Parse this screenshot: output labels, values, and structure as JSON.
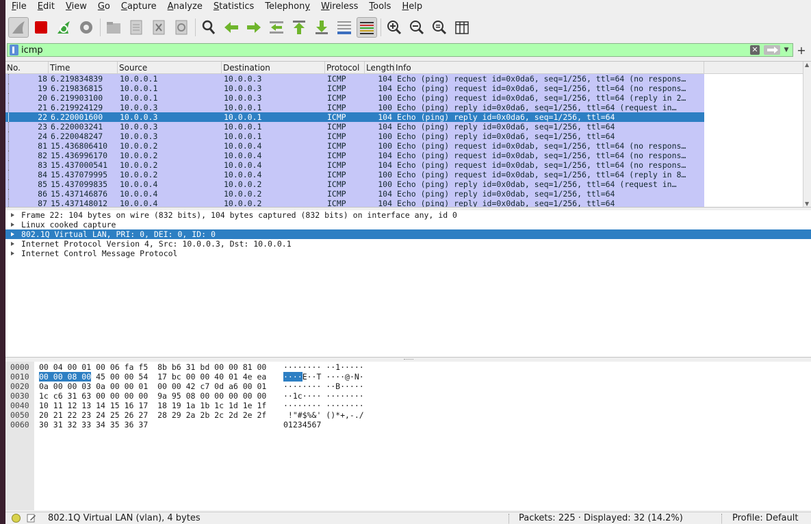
{
  "menu": [
    "File",
    "Edit",
    "View",
    "Go",
    "Capture",
    "Analyze",
    "Statistics",
    "Telephony",
    "Wireless",
    "Tools",
    "Help"
  ],
  "menu_underline": [
    "F",
    "E",
    "V",
    "G",
    "C",
    "A",
    "S",
    "y",
    "W",
    "T",
    "H"
  ],
  "filter": {
    "value": "icmp"
  },
  "columns": [
    "No.",
    "Time",
    "Source",
    "Destination",
    "Protocol",
    "Length",
    "Info"
  ],
  "packets": [
    {
      "no": "18",
      "time": "6.219834839",
      "src": "10.0.0.1",
      "dst": "10.0.0.3",
      "proto": "ICMP",
      "len": "104",
      "info": "Echo (ping) request  id=0x0da6, seq=1/256, ttl=64 (no respons…",
      "selected": false
    },
    {
      "no": "19",
      "time": "6.219836815",
      "src": "10.0.0.1",
      "dst": "10.0.0.3",
      "proto": "ICMP",
      "len": "104",
      "info": "Echo (ping) request  id=0x0da6, seq=1/256, ttl=64 (no respons…",
      "selected": false
    },
    {
      "no": "20",
      "time": "6.219903100",
      "src": "10.0.0.1",
      "dst": "10.0.0.3",
      "proto": "ICMP",
      "len": "100",
      "info": "Echo (ping) request  id=0x0da6, seq=1/256, ttl=64 (reply in 2…",
      "selected": false
    },
    {
      "no": "21",
      "time": "6.219924129",
      "src": "10.0.0.3",
      "dst": "10.0.0.1",
      "proto": "ICMP",
      "len": "100",
      "info": "Echo (ping) reply    id=0x0da6, seq=1/256, ttl=64 (request in…",
      "selected": false
    },
    {
      "no": "22",
      "time": "6.220001600",
      "src": "10.0.0.3",
      "dst": "10.0.0.1",
      "proto": "ICMP",
      "len": "104",
      "info": "Echo (ping) reply    id=0x0da6, seq=1/256, ttl=64",
      "selected": true
    },
    {
      "no": "23",
      "time": "6.220003241",
      "src": "10.0.0.3",
      "dst": "10.0.0.1",
      "proto": "ICMP",
      "len": "104",
      "info": "Echo (ping) reply    id=0x0da6, seq=1/256, ttl=64",
      "selected": false
    },
    {
      "no": "24",
      "time": "6.220048247",
      "src": "10.0.0.3",
      "dst": "10.0.0.1",
      "proto": "ICMP",
      "len": "100",
      "info": "Echo (ping) reply    id=0x0da6, seq=1/256, ttl=64",
      "selected": false
    },
    {
      "no": "81",
      "time": "15.436806410",
      "src": "10.0.0.2",
      "dst": "10.0.0.4",
      "proto": "ICMP",
      "len": "100",
      "info": "Echo (ping) request  id=0x0dab, seq=1/256, ttl=64 (no respons…",
      "selected": false
    },
    {
      "no": "82",
      "time": "15.436996170",
      "src": "10.0.0.2",
      "dst": "10.0.0.4",
      "proto": "ICMP",
      "len": "104",
      "info": "Echo (ping) request  id=0x0dab, seq=1/256, ttl=64 (no respons…",
      "selected": false
    },
    {
      "no": "83",
      "time": "15.437000541",
      "src": "10.0.0.2",
      "dst": "10.0.0.4",
      "proto": "ICMP",
      "len": "104",
      "info": "Echo (ping) request  id=0x0dab, seq=1/256, ttl=64 (no respons…",
      "selected": false
    },
    {
      "no": "84",
      "time": "15.437079995",
      "src": "10.0.0.2",
      "dst": "10.0.0.4",
      "proto": "ICMP",
      "len": "100",
      "info": "Echo (ping) request  id=0x0dab, seq=1/256, ttl=64 (reply in 8…",
      "selected": false
    },
    {
      "no": "85",
      "time": "15.437099835",
      "src": "10.0.0.4",
      "dst": "10.0.0.2",
      "proto": "ICMP",
      "len": "100",
      "info": "Echo (ping) reply    id=0x0dab, seq=1/256, ttl=64 (request in…",
      "selected": false
    },
    {
      "no": "86",
      "time": "15.437146876",
      "src": "10.0.0.4",
      "dst": "10.0.0.2",
      "proto": "ICMP",
      "len": "104",
      "info": "Echo (ping) reply    id=0x0dab, seq=1/256, ttl=64",
      "selected": false
    },
    {
      "no": "87",
      "time": "15.437148012",
      "src": "10.0.0.4",
      "dst": "10.0.0.2",
      "proto": "ICMP",
      "len": "104",
      "info": "Echo (ping) reply    id=0x0dab, seq=1/256, ttl=64",
      "selected": false
    }
  ],
  "details": [
    {
      "text": "Frame 22: 104 bytes on wire (832 bits), 104 bytes captured (832 bits) on interface any, id 0",
      "selected": false
    },
    {
      "text": "Linux cooked capture",
      "selected": false
    },
    {
      "text": "802.1Q Virtual LAN, PRI: 0, DEI: 0, ID: 0",
      "selected": true
    },
    {
      "text": "Internet Protocol Version 4, Src: 10.0.0.3, Dst: 10.0.0.1",
      "selected": false
    },
    {
      "text": "Internet Control Message Protocol",
      "selected": false
    }
  ],
  "bytes": [
    {
      "off": "0000",
      "hex_pre": "",
      "hex_hl": "",
      "hex_post": "00 04 00 01 00 06 fa f5  8b b6 31 bd 00 00 81 00",
      "asc_pre": "",
      "asc_hl": "",
      "asc_post": "········ ··1·····"
    },
    {
      "off": "0010",
      "hex_pre": "",
      "hex_hl": "00 00 08 00",
      "hex_post": " 45 00 00 54  17 bc 00 00 40 01 4e ea",
      "asc_pre": "",
      "asc_hl": "····",
      "asc_post": "E··T ····@·N·"
    },
    {
      "off": "0020",
      "hex_pre": "",
      "hex_hl": "",
      "hex_post": "0a 00 00 03 0a 00 00 01  00 00 42 c7 0d a6 00 01",
      "asc_pre": "",
      "asc_hl": "",
      "asc_post": "········ ··B·····"
    },
    {
      "off": "0030",
      "hex_pre": "",
      "hex_hl": "",
      "hex_post": "1c c6 31 63 00 00 00 00  9a 95 08 00 00 00 00 00",
      "asc_pre": "",
      "asc_hl": "",
      "asc_post": "··1c···· ········"
    },
    {
      "off": "0040",
      "hex_pre": "",
      "hex_hl": "",
      "hex_post": "10 11 12 13 14 15 16 17  18 19 1a 1b 1c 1d 1e 1f",
      "asc_pre": "",
      "asc_hl": "",
      "asc_post": "········ ········"
    },
    {
      "off": "0050",
      "hex_pre": "",
      "hex_hl": "",
      "hex_post": "20 21 22 23 24 25 26 27  28 29 2a 2b 2c 2d 2e 2f",
      "asc_pre": "",
      "asc_hl": "",
      "asc_post": " !\"#$%&' ()*+,-./"
    },
    {
      "off": "0060",
      "hex_pre": "",
      "hex_hl": "",
      "hex_post": "30 31 32 33 34 35 36 37",
      "asc_pre": "",
      "asc_hl": "",
      "asc_post": "01234567"
    }
  ],
  "status": {
    "field": "802.1Q Virtual LAN (vlan), 4 bytes",
    "packets": "Packets: 225 · Displayed: 32 (14.2%)",
    "profile": "Profile: Default"
  },
  "colors": {
    "row_bg": "#c6c7f8",
    "selected": "#2d7fc3",
    "filter_ok": "#afffaf"
  }
}
